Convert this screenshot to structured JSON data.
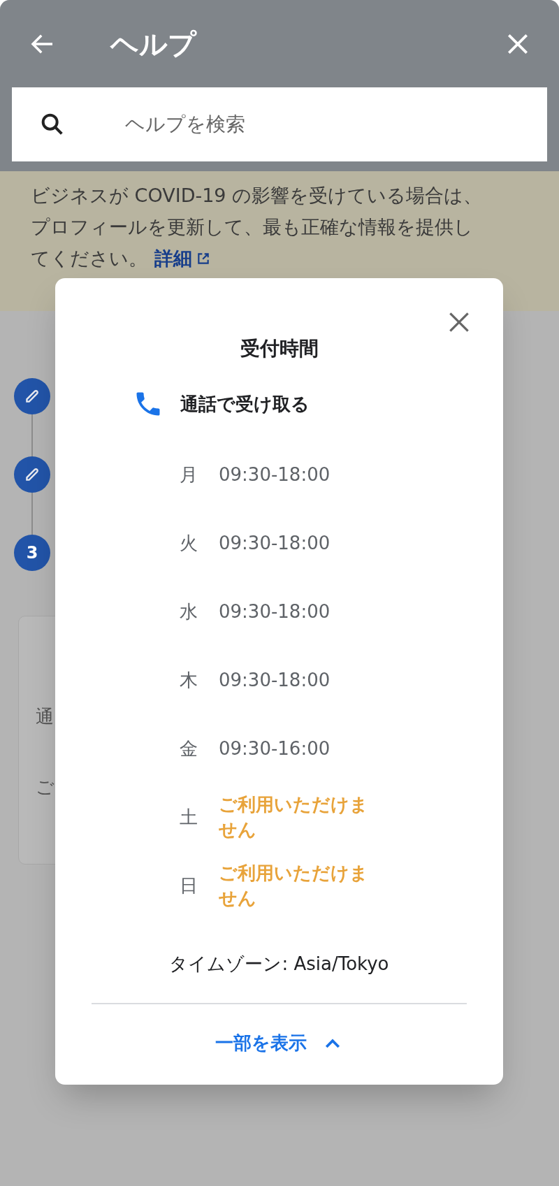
{
  "header": {
    "title": "ヘルプ",
    "search": {
      "placeholder": "ヘルプを検索"
    }
  },
  "banner": {
    "lines": [
      "ビジネスが COVID-19 の影響を受けている場合は、",
      "プロフィールを更新して、最も正確な情報を提供し",
      "てください。"
    ],
    "link": "詳細"
  },
  "steps": [
    {
      "kind": "edit"
    },
    {
      "kind": "edit"
    },
    {
      "kind": "number",
      "label": "3"
    }
  ],
  "background_card": {
    "lines": [
      "通",
      "ご"
    ]
  },
  "dialog": {
    "title": "受付時間",
    "method": "通話で受け取る",
    "hours": [
      {
        "day": "月",
        "time": "09:30-18:00",
        "available": true
      },
      {
        "day": "火",
        "time": "09:30-18:00",
        "available": true
      },
      {
        "day": "水",
        "time": "09:30-18:00",
        "available": true
      },
      {
        "day": "木",
        "time": "09:30-18:00",
        "available": true
      },
      {
        "day": "金",
        "time": "09:30-16:00",
        "available": true
      },
      {
        "day": "土",
        "time": "ご利用いただけません",
        "available": false
      },
      {
        "day": "日",
        "time": "ご利用いただけません",
        "available": false
      }
    ],
    "timezone": "タイムゾーン: Asia/Tokyo",
    "toggle": {
      "label": "一部を表示",
      "expanded": true
    }
  }
}
